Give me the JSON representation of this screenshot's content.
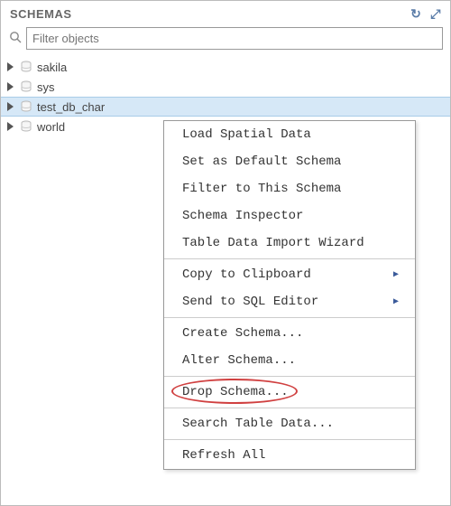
{
  "header": {
    "title": "SCHEMAS"
  },
  "search": {
    "placeholder": "Filter objects"
  },
  "tree": {
    "items": [
      {
        "label": "sakila",
        "selected": false
      },
      {
        "label": "sys",
        "selected": false
      },
      {
        "label": "test_db_char",
        "selected": true
      },
      {
        "label": "world",
        "selected": false
      }
    ]
  },
  "context_menu": {
    "groups": [
      [
        {
          "label": "Load Spatial Data"
        },
        {
          "label": "Set as Default Schema"
        },
        {
          "label": "Filter to This Schema"
        },
        {
          "label": "Schema Inspector"
        },
        {
          "label": "Table Data Import Wizard"
        }
      ],
      [
        {
          "label": "Copy to Clipboard",
          "submenu": true
        },
        {
          "label": "Send to SQL Editor",
          "submenu": true
        }
      ],
      [
        {
          "label": "Create Schema..."
        },
        {
          "label": "Alter Schema..."
        }
      ],
      [
        {
          "label": "Drop Schema...",
          "highlighted": true
        }
      ],
      [
        {
          "label": "Search Table Data..."
        }
      ],
      [
        {
          "label": "Refresh All"
        }
      ]
    ]
  }
}
